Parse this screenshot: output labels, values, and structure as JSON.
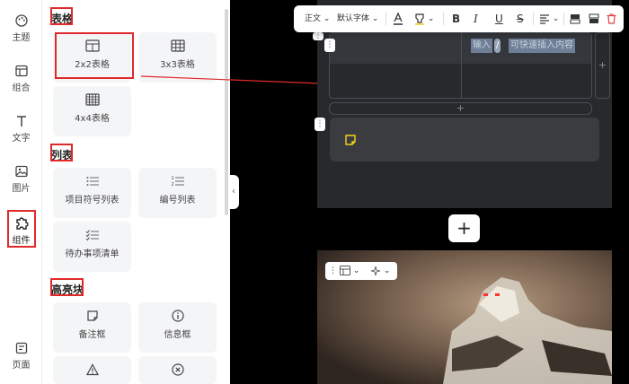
{
  "rail": {
    "items": [
      {
        "label": "主题",
        "icon": "palette-icon"
      },
      {
        "label": "组合",
        "icon": "layout-icon"
      },
      {
        "label": "文字",
        "icon": "text-icon"
      },
      {
        "label": "图片",
        "icon": "image-icon"
      },
      {
        "label": "组件",
        "icon": "puzzle-icon",
        "active": true
      },
      {
        "label": "页面",
        "icon": "page-icon"
      }
    ]
  },
  "panel": {
    "sections": [
      {
        "title": "表格",
        "cards": [
          "2x2表格",
          "3x3表格",
          "4x4表格"
        ]
      },
      {
        "title": "列表",
        "cards": [
          "项目符号列表",
          "编号列表",
          "待办事项清单"
        ]
      },
      {
        "title": "高亮块",
        "cards": [
          "备注框",
          "信息框"
        ]
      }
    ]
  },
  "toolbar": {
    "paragraph_style": "正文",
    "font": "默认字体"
  },
  "editor": {
    "table_placeholder_a": "输入",
    "table_placeholder_b": "/",
    "table_placeholder_c": "可快速插入内容"
  },
  "colors": {
    "accent_red": "#e02a2a",
    "note_icon": "#f2d21b",
    "delete_icon": "#e04040"
  }
}
